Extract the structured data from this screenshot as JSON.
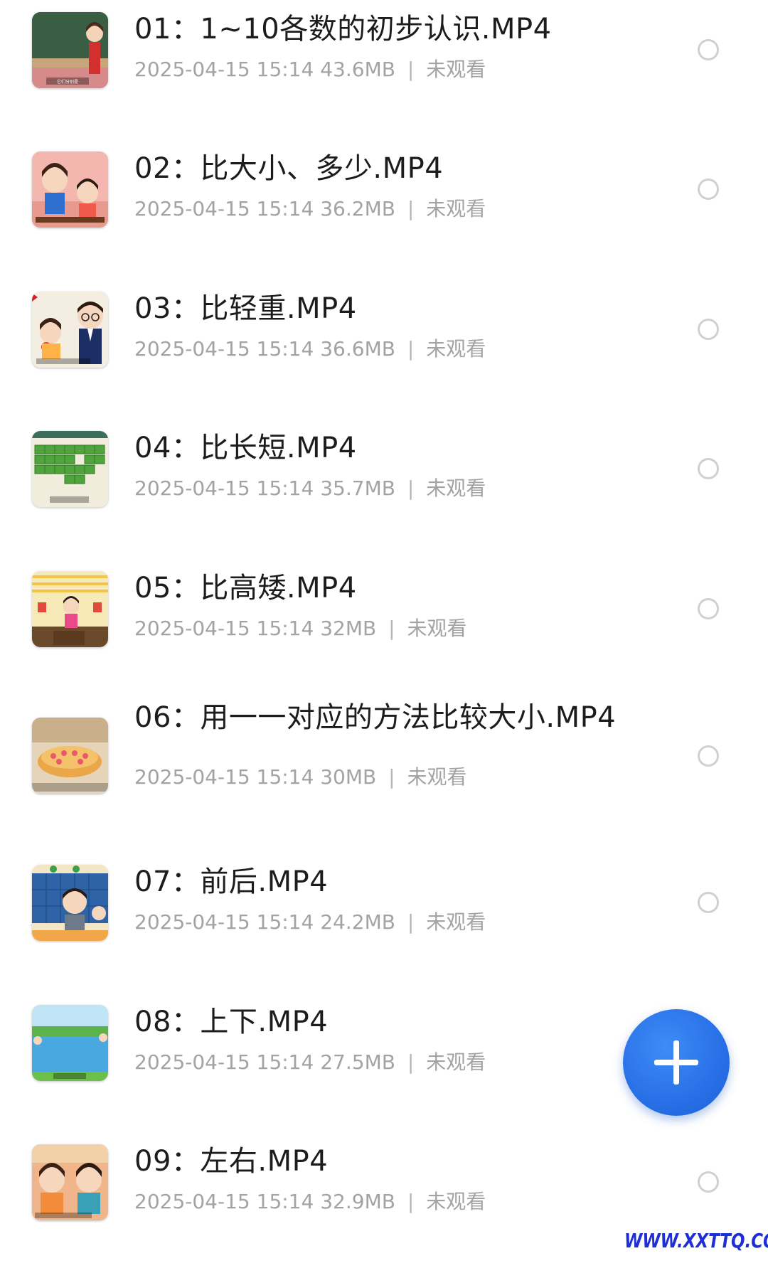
{
  "videos": [
    {
      "title": "01：1~10各数的初步认识.MP4",
      "datetime": "2025-04-15 15:14",
      "size": "43.6MB",
      "separator": "|",
      "status": "未观看",
      "thumb_caption": "它们分别是"
    },
    {
      "title": "02：比大小、多少.MP4",
      "datetime": "2025-04-15 15:14",
      "size": "36.2MB",
      "separator": "|",
      "status": "未观看",
      "thumb_caption": ""
    },
    {
      "title": "03：比轻重.MP4",
      "datetime": "2025-04-15 15:14",
      "size": "36.6MB",
      "separator": "|",
      "status": "未观看",
      "thumb_caption": ""
    },
    {
      "title": "04：比长短.MP4",
      "datetime": "2025-04-15 15:14",
      "size": "35.7MB",
      "separator": "|",
      "status": "未观看",
      "thumb_caption": ""
    },
    {
      "title": "05：比高矮.MP4",
      "datetime": "2025-04-15 15:14",
      "size": "32MB",
      "separator": "|",
      "status": "未观看",
      "thumb_caption": ""
    },
    {
      "title": "06：用一一对应的方法比较大小.MP4",
      "datetime": "2025-04-15 15:14",
      "size": "30MB",
      "separator": "|",
      "status": "未观看",
      "thumb_caption": ""
    },
    {
      "title": "07：前后.MP4",
      "datetime": "2025-04-15 15:14",
      "size": "24.2MB",
      "separator": "|",
      "status": "未观看",
      "thumb_caption": ""
    },
    {
      "title": "08：上下.MP4",
      "datetime": "2025-04-15 15:14",
      "size": "27.5MB",
      "separator": "|",
      "status": "未观看",
      "thumb_caption": ""
    },
    {
      "title": "09：左右.MP4",
      "datetime": "2025-04-15 15:14",
      "size": "32.9MB",
      "separator": "|",
      "status": "未观看",
      "thumb_caption": ""
    }
  ],
  "fab": {
    "icon": "plus-icon",
    "color": "#2a72e8"
  },
  "watermark": "WWW.XXTTQ.COM",
  "colors": {
    "title": "#1c1c1c",
    "meta": "#a3a3a3",
    "radio_border": "#d0d0d0",
    "accent": "#2a72e8",
    "watermark": "#1e2fd8"
  }
}
